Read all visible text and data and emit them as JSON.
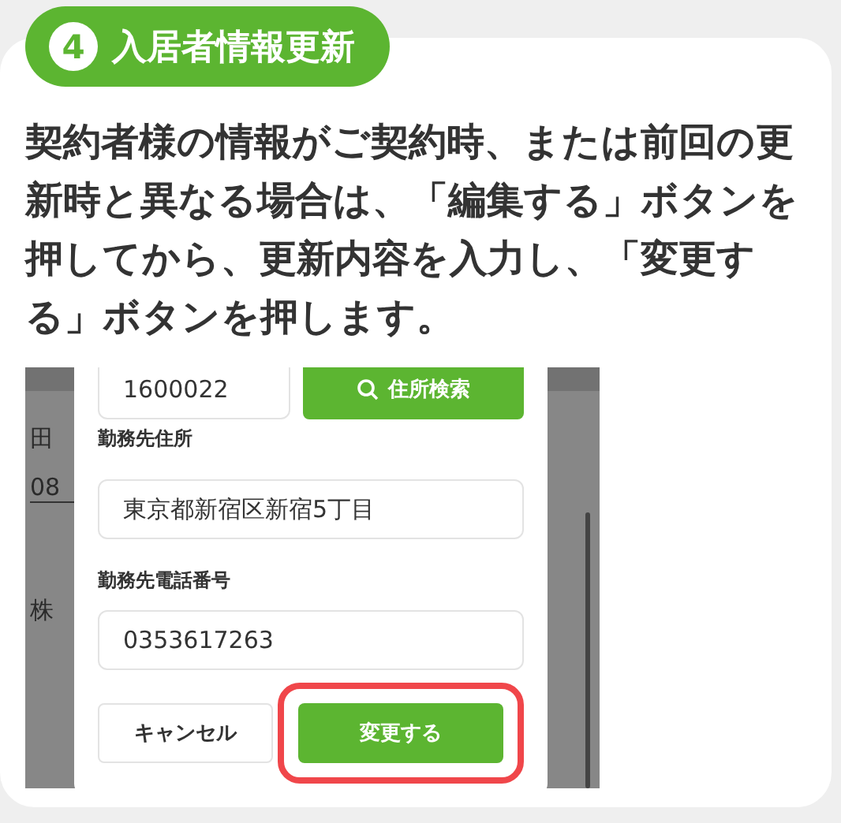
{
  "header": {
    "number": "4",
    "title": "入居者情報更新"
  },
  "description": "契約者様の情報がご契約時、または前回の更新時と異なる場合は、「編集する」ボタンを押してから、更新内容を入力し、「変更する」ボタンを押します。",
  "screenshot": {
    "background_fields": [
      {
        "value": "田"
      },
      {
        "value": "08"
      },
      {
        "value": "株"
      }
    ],
    "modal": {
      "postal_code": "1600022",
      "search_button": "住所検索",
      "fields": [
        {
          "label": "勤務先住所",
          "value": "東京都新宿区新宿5丁目"
        },
        {
          "label": "勤務先電話番号",
          "value": "0353617263"
        }
      ],
      "buttons": [
        {
          "label": "キャンセル",
          "kind": "secondary",
          "highlighted": false
        },
        {
          "label": "変更する",
          "kind": "primary",
          "highlighted": true
        }
      ]
    }
  }
}
